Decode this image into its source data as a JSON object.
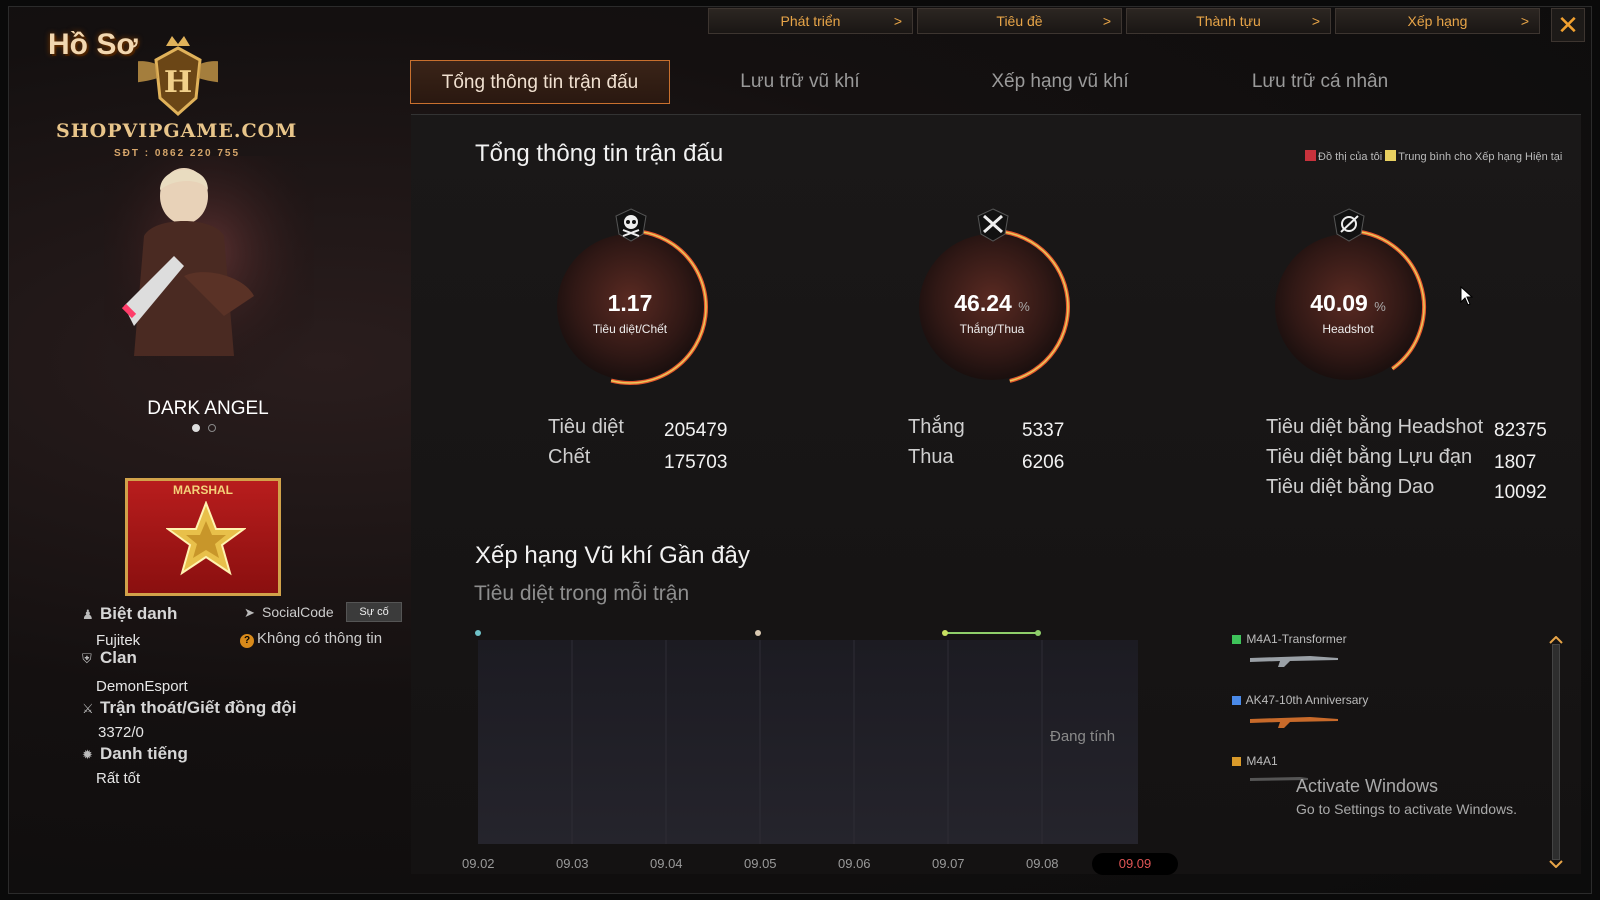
{
  "window": {
    "title": "Hồ Sơ",
    "close_icon": "close-icon",
    "accent": "#e8a548"
  },
  "logo": {
    "brand": "SHOPVIPGAME.COM",
    "phone": "SĐT : 0862 220 755"
  },
  "top_menu": [
    {
      "label": "Phát triển",
      "chev": ">"
    },
    {
      "label": "Tiêu đề",
      "chev": ">"
    },
    {
      "label": "Thành tựu",
      "chev": ">"
    },
    {
      "label": "Xếp hạng",
      "chev": ">"
    }
  ],
  "tabs": [
    {
      "label": "Tổng thông tin trận đấu",
      "active": true
    },
    {
      "label": "Lưu trữ vũ khí",
      "active": false
    },
    {
      "label": "Xếp hạng vũ khí",
      "active": false
    },
    {
      "label": "Lưu trữ cá nhân",
      "active": false
    }
  ],
  "profile": {
    "character_name": "DARK ANGEL",
    "rank_title": "MARSHAL",
    "nickname_label": "Biệt danh",
    "nickname": "Fujitek",
    "socialcode_label": "SocialCode",
    "report_button": "Sự cố",
    "socialcode_value": "Không có thông tin",
    "clan_label": "Clan",
    "clan": "DemonEsport",
    "escape_label": "Trận thoát/Giết đồng đội",
    "escape_value": "3372/0",
    "reputation_label": "Danh tiếng",
    "reputation": "Rất tốt"
  },
  "overview": {
    "title": "Tổng thông tin trận đấu",
    "legend_mine": "Đồ thị của tôi",
    "legend_avg": "Trung bình cho Xếp hạng Hiện tại",
    "legend_mine_color": "#c8323c",
    "legend_avg_color": "#e8d060",
    "gauges": [
      {
        "value": "1.17",
        "unit": "",
        "label": "Tiêu diệt/Chết",
        "fraction": 0.54,
        "icon": "skull-icon"
      },
      {
        "value": "46.24",
        "unit": "%",
        "label": "Thắng/Thua",
        "fraction": 0.4624,
        "icon": "crossed-swords-icon"
      },
      {
        "value": "40.09",
        "unit": "%",
        "label": "Headshot",
        "fraction": 0.4009,
        "icon": "crosshair-icon"
      }
    ],
    "kd": {
      "kill_label": "Tiêu diệt",
      "kill": "205479",
      "death_label": "Chết",
      "death": "175703"
    },
    "wl": {
      "win_label": "Thắng",
      "win": "5337",
      "lose_label": "Thua",
      "lose": "6206"
    },
    "kills": {
      "headshot_label": "Tiêu diệt bằng Headshot",
      "headshot": "82375",
      "grenade_label": "Tiêu diệt bằng Lựu đạn",
      "grenade": "1807",
      "knife_label": "Tiêu diệt bằng Dao",
      "knife": "10092"
    }
  },
  "weapon_rank": {
    "title": "Xếp hạng Vũ khí Gần đây",
    "subtitle": "Tiêu diệt trong mỗi trận",
    "status": "Đang tính",
    "dates": [
      "09.02",
      "09.03",
      "09.04",
      "09.05",
      "09.06",
      "09.07",
      "09.08",
      "09.09"
    ],
    "active_date": "09.09",
    "weapons": [
      {
        "name": "M4A1-Transformer",
        "color": "#3ec35a"
      },
      {
        "name": "AK47-10th Anniversary",
        "color": "#4a8ae8"
      },
      {
        "name": "M4A1",
        "color": "#d99a2a"
      }
    ]
  },
  "watermark": {
    "line1": "Activate Windows",
    "line2": "Go to Settings to activate Windows."
  }
}
